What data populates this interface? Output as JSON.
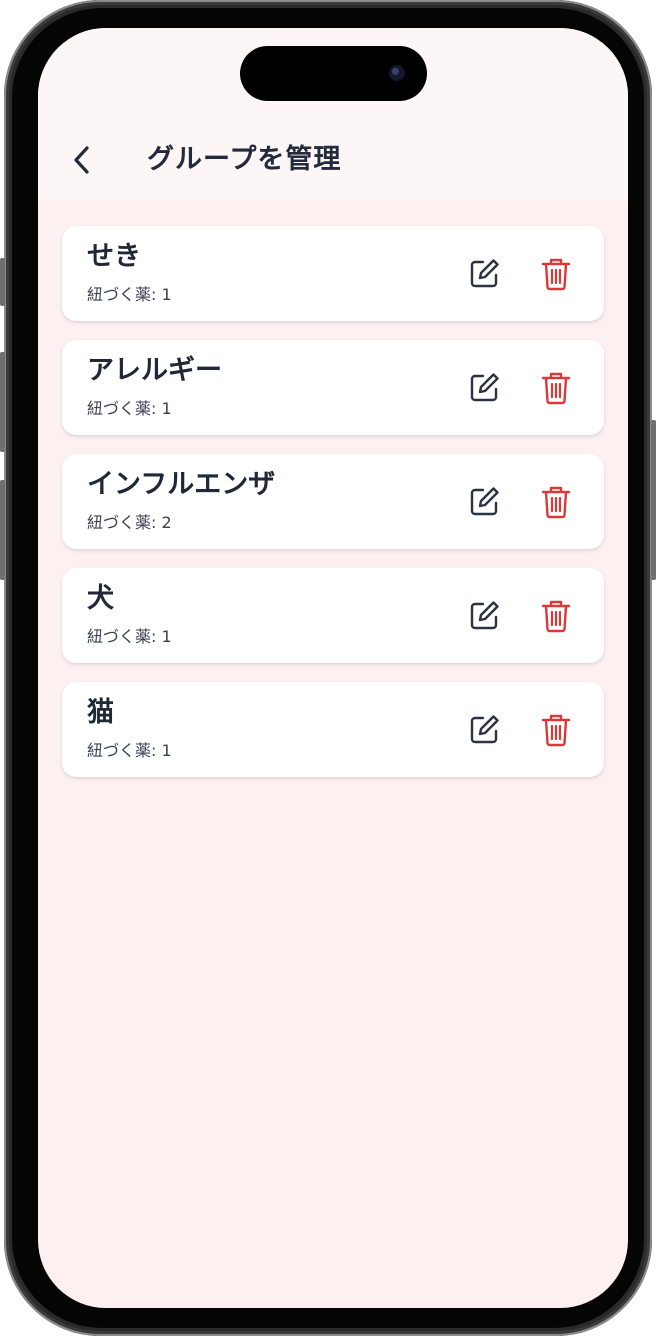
{
  "header": {
    "title": "グループを管理",
    "back_icon": "chevron-left-icon"
  },
  "groups": [
    {
      "name": "せき",
      "meds_label": "紐づく薬: 1"
    },
    {
      "name": "アレルギー",
      "meds_label": "紐づく薬: 1"
    },
    {
      "name": "インフルエンザ",
      "meds_label": "紐づく薬: 2"
    },
    {
      "name": "犬",
      "meds_label": "紐づく薬: 1"
    },
    {
      "name": "猫",
      "meds_label": "紐づく薬: 1"
    }
  ],
  "icons": {
    "edit": "edit-icon",
    "delete": "trash-icon"
  },
  "colors": {
    "background": "#fcf0f1",
    "header_background": "#fdf6f7",
    "card": "#ffffff",
    "text": "#232a3b",
    "edit_icon": "#2b3243",
    "delete_icon": "#d83a3a"
  }
}
